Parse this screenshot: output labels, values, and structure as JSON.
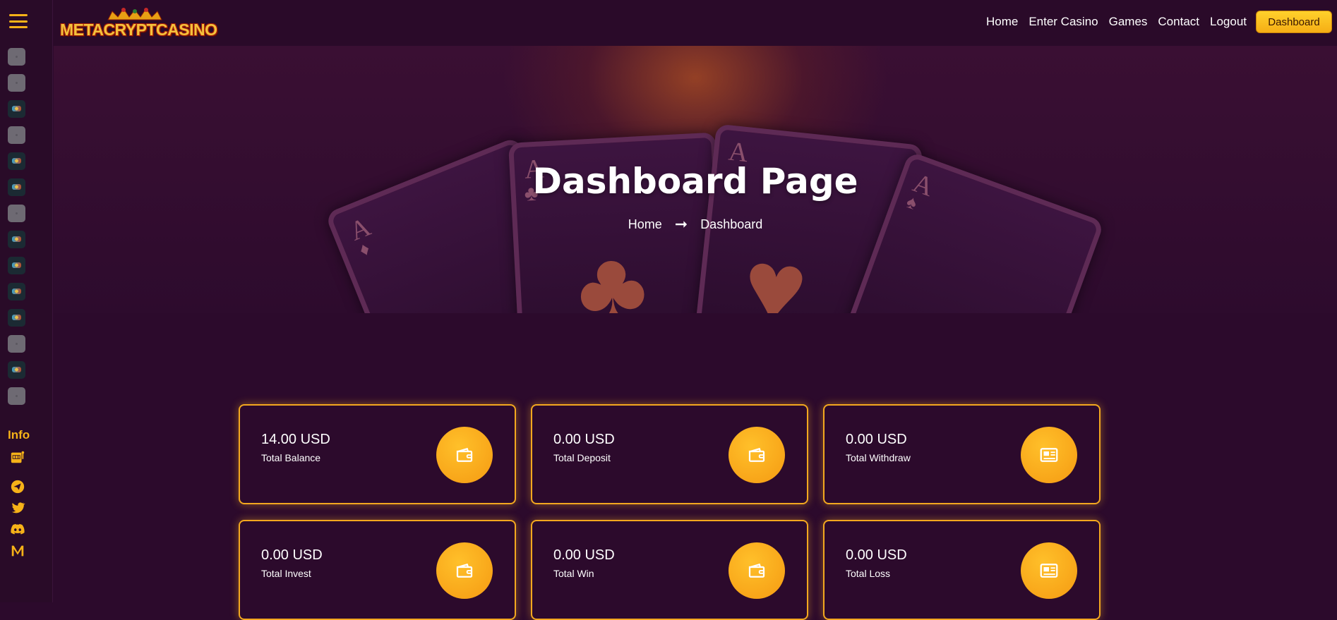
{
  "app": {
    "logo_text": "METACRYPTCASINO"
  },
  "header": {
    "nav": [
      "Home",
      "Enter Casino",
      "Games",
      "Contact",
      "Logout"
    ],
    "dashboard_button": "Dashboard"
  },
  "sidebar": {
    "menu_icon": "hamburger-menu-icon",
    "game_icons": [
      "game-thumb",
      "game-thumb",
      "game-thumb",
      "game-thumb",
      "game-thumb",
      "game-thumb",
      "game-thumb",
      "game-thumb",
      "game-thumb",
      "game-thumb",
      "game-thumb",
      "game-thumb",
      "game-thumb",
      "game-thumb"
    ],
    "info_label": "Info",
    "social_icons": [
      "slot-machine-icon",
      "telegram-icon",
      "twitter-icon",
      "discord-icon",
      "medium-icon"
    ]
  },
  "hero": {
    "title": "Dashboard Page",
    "breadcrumb": {
      "home": "Home",
      "current": "Dashboard"
    }
  },
  "stats": [
    {
      "value": "14.00 USD",
      "label": "Total Balance",
      "icon": "wallet-icon"
    },
    {
      "value": "0.00 USD",
      "label": "Total Deposit",
      "icon": "wallet-icon"
    },
    {
      "value": "0.00 USD",
      "label": "Total Withdraw",
      "icon": "id-card-icon"
    },
    {
      "value": "0.00 USD",
      "label": "Total Invest",
      "icon": "wallet-icon"
    },
    {
      "value": "0.00 USD",
      "label": "Total Win",
      "icon": "wallet-icon"
    },
    {
      "value": "0.00 USD",
      "label": "Total Loss",
      "icon": "id-card-icon"
    }
  ],
  "colors": {
    "background": "#2c0a2c",
    "accent": "#f6b218",
    "card_border": "#f3a81f"
  }
}
